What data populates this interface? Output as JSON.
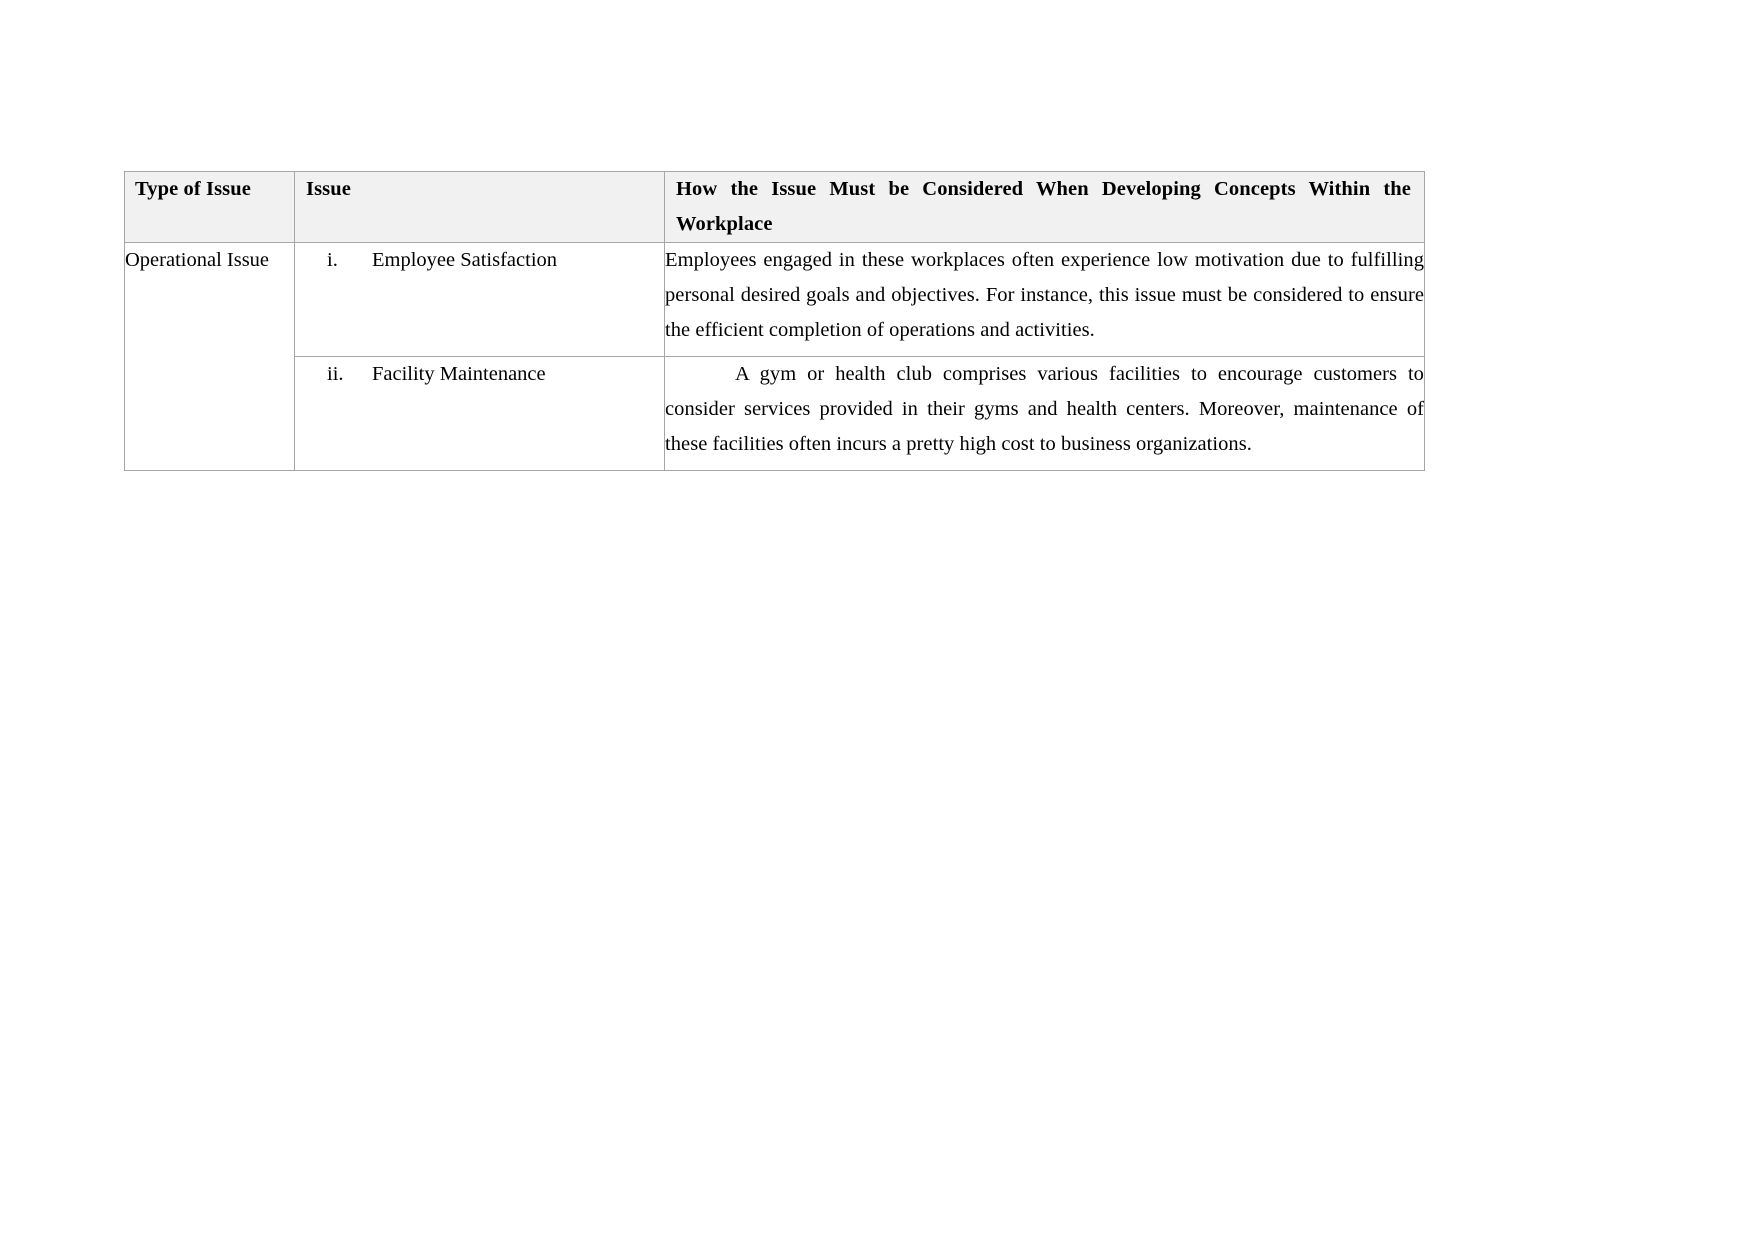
{
  "document": {
    "type": "table",
    "columns": [
      {
        "key": "type_of_issue",
        "header": "Type of Issue"
      },
      {
        "key": "issue",
        "header": "Issue"
      },
      {
        "key": "how_considered",
        "header": "How the Issue Must be Considered When Developing Concepts Within the Workplace"
      }
    ],
    "rows": [
      {
        "type_of_issue": "Operational Issue",
        "issue_number": "i.",
        "issue_label": "Employee Satisfaction",
        "how_considered": "Employees engaged in these workplaces often experience low motivation due to fulfilling personal desired goals and objectives. For instance, this issue must be considered to ensure the efficient completion of operations and activities.",
        "first_line_indent": false
      },
      {
        "type_of_issue": "",
        "issue_number": "ii.",
        "issue_label": "Facility Maintenance",
        "how_considered": "A gym or health club comprises various facilities to encourage customers to consider services provided in their gyms and health centers. Moreover, maintenance of these facilities often incurs a pretty high cost to business organizations.",
        "first_line_indent": true
      }
    ]
  },
  "style": {
    "header_background": "#f1f1f1",
    "border_color": "#a6a6a6",
    "text_color": "#000000",
    "page_background": "#ffffff"
  }
}
